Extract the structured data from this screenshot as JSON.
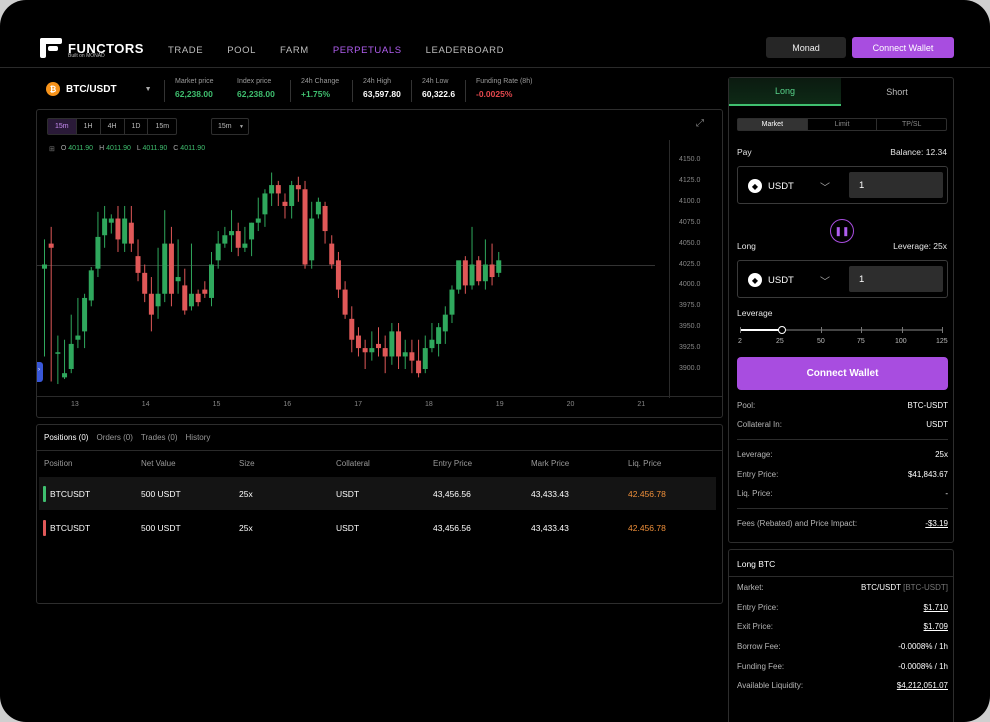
{
  "brand": {
    "name": "FUNCTORS",
    "tagline": "Built on MONAD"
  },
  "nav": [
    "TRADE",
    "POOL",
    "FARM",
    "PERPETUALS",
    "LEADERBOARD"
  ],
  "nav_active": "PERPETUALS",
  "header_buttons": {
    "network": "Monad",
    "connect": "Connect Wallet"
  },
  "ticker": {
    "pair": "BTC/USDT",
    "coin_icon": "bitcoin-icon",
    "stats": [
      {
        "label": "Market price",
        "value": "62,238.00",
        "color": "#3fbf6f"
      },
      {
        "label": "Index price",
        "value": "62,238.00",
        "color": "#3fbf6f"
      },
      {
        "label": "24h Change",
        "value": "+1.75%",
        "color": "#3fbf6f"
      },
      {
        "label": "24h High",
        "value": "63,597.80",
        "color": "#ffffff"
      },
      {
        "label": "24h Low",
        "value": "60,322.6",
        "color": "#ffffff"
      },
      {
        "label": "Funding Rate (8h)",
        "value": "-0.0025%",
        "color": "#e5484d"
      }
    ]
  },
  "chart_toolbar": {
    "timeframes": [
      "15m",
      "1H",
      "4H",
      "1D",
      "15m"
    ],
    "active": "15m",
    "select": "15m"
  },
  "ohlc": {
    "o_label": "O",
    "o": "4011.90",
    "h_label": "H",
    "h": "4011.90",
    "l_label": "L",
    "l": "4011.90",
    "c_label": "C",
    "c": "4011.90"
  },
  "chart_data": {
    "type": "candlestick",
    "y_ticks": [
      "4150.0",
      "4125.0",
      "4100.0",
      "4075.0",
      "4050.0",
      "4025.0",
      "4000.0",
      "3975.0",
      "3950.0",
      "3925.0",
      "3900.0"
    ],
    "ylim": [
      3900,
      4150
    ],
    "x_ticks": [
      "13",
      "14",
      "15",
      "16",
      "17",
      "18",
      "19",
      "20",
      "21"
    ],
    "last_price": 4025,
    "up_color": "#2fa85d",
    "down_color": "#e05858",
    "candles": [
      [
        4020,
        4055,
        4025,
        3915
      ],
      [
        4050,
        4070,
        4045,
        3885
      ],
      [
        3920,
        3940,
        3920,
        3882
      ],
      [
        3890,
        3935,
        3895,
        3888
      ],
      [
        3900,
        3965,
        3930,
        3895
      ],
      [
        3935,
        3985,
        3940,
        3925
      ],
      [
        3945,
        3990,
        3985,
        3925
      ],
      [
        3982,
        4022,
        4018,
        3975
      ],
      [
        4020,
        4088,
        4058,
        4010
      ],
      [
        4060,
        4095,
        4080,
        4045
      ],
      [
        4075,
        4085,
        4080,
        4062
      ],
      [
        4080,
        4095,
        4055,
        4040
      ],
      [
        4050,
        4095,
        4080,
        4040
      ],
      [
        4075,
        4095,
        4050,
        4040
      ],
      [
        4035,
        4055,
        4015,
        4005
      ],
      [
        4015,
        4025,
        3990,
        3980
      ],
      [
        3990,
        4010,
        3965,
        3945
      ],
      [
        3975,
        4045,
        3990,
        3960
      ],
      [
        3990,
        4090,
        4050,
        3980
      ],
      [
        4050,
        4070,
        3990,
        3975
      ],
      [
        4005,
        4055,
        4010,
        3990
      ],
      [
        4000,
        4020,
        3970,
        3965
      ],
      [
        3975,
        4050,
        3990,
        3970
      ],
      [
        3990,
        3995,
        3980,
        3975
      ],
      [
        3995,
        4005,
        3990,
        3985
      ],
      [
        3985,
        4040,
        4025,
        3975
      ],
      [
        4030,
        4065,
        4050,
        4020
      ],
      [
        4050,
        4070,
        4060,
        4045
      ],
      [
        4060,
        4090,
        4065,
        4040
      ],
      [
        4065,
        4075,
        4045,
        4035
      ],
      [
        4045,
        4070,
        4050,
        4040
      ],
      [
        4055,
        4075,
        4075,
        4035
      ],
      [
        4075,
        4105,
        4080,
        4065
      ],
      [
        4085,
        4115,
        4110,
        4070
      ],
      [
        4110,
        4135,
        4120,
        4095
      ],
      [
        4120,
        4125,
        4110,
        4095
      ],
      [
        4100,
        4110,
        4095,
        4080
      ],
      [
        4095,
        4125,
        4120,
        4080
      ],
      [
        4120,
        4130,
        4115,
        4100
      ],
      [
        4115,
        4125,
        4025,
        4020
      ],
      [
        4030,
        4100,
        4080,
        4020
      ],
      [
        4085,
        4105,
        4100,
        4080
      ],
      [
        4095,
        4100,
        4065,
        4050
      ],
      [
        4050,
        4060,
        4025,
        4020
      ],
      [
        4030,
        4040,
        3995,
        3985
      ],
      [
        3995,
        4005,
        3965,
        3960
      ],
      [
        3960,
        3975,
        3935,
        3920
      ],
      [
        3940,
        3950,
        3925,
        3915
      ],
      [
        3925,
        3935,
        3920,
        3900
      ],
      [
        3920,
        3945,
        3925,
        3910
      ],
      [
        3930,
        3950,
        3925,
        3915
      ],
      [
        3925,
        3940,
        3915,
        3895
      ],
      [
        3915,
        3955,
        3945,
        3905
      ],
      [
        3945,
        3955,
        3915,
        3900
      ],
      [
        3915,
        3935,
        3920,
        3900
      ],
      [
        3920,
        3935,
        3910,
        3895
      ],
      [
        3910,
        3935,
        3895,
        3890
      ],
      [
        3900,
        3940,
        3925,
        3895
      ],
      [
        3925,
        3955,
        3935,
        3920
      ],
      [
        3930,
        3955,
        3950,
        3915
      ],
      [
        3945,
        3975,
        3965,
        3930
      ],
      [
        3965,
        4000,
        3995,
        3955
      ],
      [
        3995,
        4025,
        4030,
        3990
      ],
      [
        4030,
        4035,
        4000,
        3990
      ],
      [
        4000,
        4070,
        4025,
        3995
      ],
      [
        4030,
        4035,
        4005,
        4000
      ],
      [
        4005,
        4055,
        4025,
        3995
      ],
      [
        4025,
        4050,
        4010,
        4000
      ],
      [
        4015,
        4040,
        4030,
        4010
      ]
    ]
  },
  "positions": {
    "tabs": [
      "Positions (0)",
      "Orders (0)",
      "Trades (0)",
      "History"
    ],
    "columns": [
      "Position",
      "Net Value",
      "Size",
      "Collateral",
      "Entry Price",
      "Mark Price",
      "Liq. Price"
    ],
    "rows": [
      {
        "side": "long",
        "cells": [
          "BTCUSDT",
          "500 USDT",
          "25x",
          "USDT",
          "43,456.56",
          "43,433.43",
          "42.456.78"
        ]
      },
      {
        "side": "short",
        "cells": [
          "BTCUSDT",
          "500 USDT",
          "25x",
          "USDT",
          "43,456.56",
          "43,433.43",
          "42.456.78"
        ]
      }
    ]
  },
  "trade": {
    "long": "Long",
    "short": "Short",
    "order_types": [
      "Market",
      "Limit",
      "TP/SL"
    ],
    "pay_label": "Pay",
    "balance": "Balance: 12.34",
    "pay_token": "USDT",
    "pay_amount": "1",
    "long_label": "Long",
    "leverage_label": "Leverage: 25x",
    "long_token": "USDT",
    "long_amount": "1",
    "slider_title": "Leverage",
    "slider_marks": [
      "2",
      "25",
      "50",
      "75",
      "100",
      "125"
    ],
    "slider_value": 25,
    "connect": "Connect Wallet",
    "details": [
      {
        "k": "Pool:",
        "v": "BTC-USDT"
      },
      {
        "k": "Collateral In:",
        "v": "USDT"
      },
      {
        "k": "Leverage:",
        "v": "25x"
      },
      {
        "k": "Entry Price:",
        "v": "$41,843.67"
      },
      {
        "k": "Liq. Price:",
        "v": "-"
      },
      {
        "k": "Fees (Rebated) and Price Impact:",
        "v": "-$3.19"
      }
    ]
  },
  "long_btc": {
    "title": "Long BTC",
    "market_k": "Market:",
    "market_v": "BTC/USDT",
    "market_sub": "[BTC-USDT]",
    "rows": [
      {
        "k": "Entry Price:",
        "v": "$1.710"
      },
      {
        "k": "Exit Price:",
        "v": "$1.709"
      },
      {
        "k": "Borrow Fee:",
        "v": "-0.0008% / 1h"
      },
      {
        "k": "Funding Fee:",
        "v": "-0.0008% / 1h"
      },
      {
        "k": "Available Liquidity:",
        "v": "$4,212,051.07"
      }
    ]
  }
}
